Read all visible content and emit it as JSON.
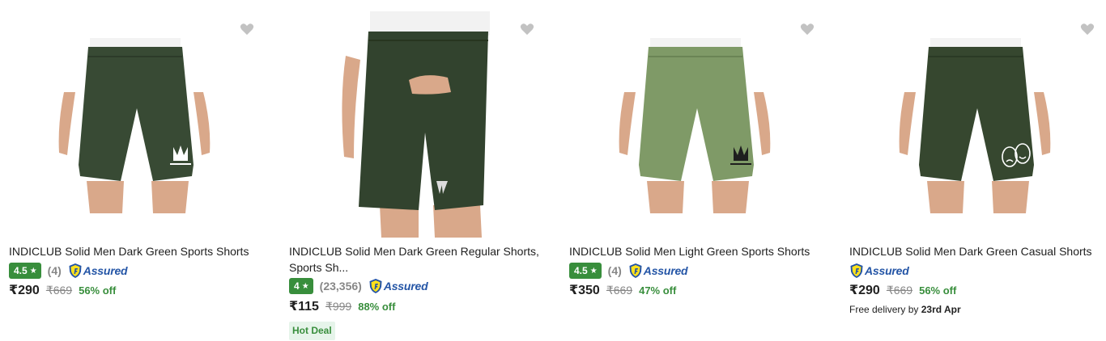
{
  "products": [
    {
      "title": "INDICLUB Solid Men Dark Green Sports Shorts",
      "rating": "4.5",
      "rating_count": "(4)",
      "assured_label": "Assured",
      "price": "₹290",
      "mrp": "₹669",
      "discount": "56% off",
      "short_color": "#384a34",
      "print_icon": "crown-logo"
    },
    {
      "title": "INDICLUB Solid Men Dark Green Regular Shorts, Sports Sh...",
      "rating": "4",
      "rating_count": "(23,356)",
      "assured_label": "Assured",
      "price": "₹115",
      "mrp": "₹999",
      "discount": "88% off",
      "deal": "Hot Deal",
      "short_color": "#32432e",
      "print_icon": "jx-logo"
    },
    {
      "title": "INDICLUB Solid Men Light Green Sports Shorts",
      "rating": "4.5",
      "rating_count": "(4)",
      "assured_label": "Assured",
      "price": "₹350",
      "mrp": "₹669",
      "discount": "47% off",
      "short_color": "#7f9a67",
      "print_icon": "crown-logo"
    },
    {
      "title": "INDICLUB Solid Men Dark Green Casual Shorts",
      "assured_label": "Assured",
      "price": "₹290",
      "mrp": "₹669",
      "discount": "56% off",
      "delivery_prefix": "Free delivery by",
      "delivery_date": "23rd Apr",
      "short_color": "#36472f",
      "print_icon": "theatre-masks-logo"
    }
  ],
  "colors": {
    "rating_green": "#388e3c",
    "assured_blue": "#2455a6",
    "wishlist_grey": "#c2c2c2",
    "skin": "#d9a88a"
  }
}
